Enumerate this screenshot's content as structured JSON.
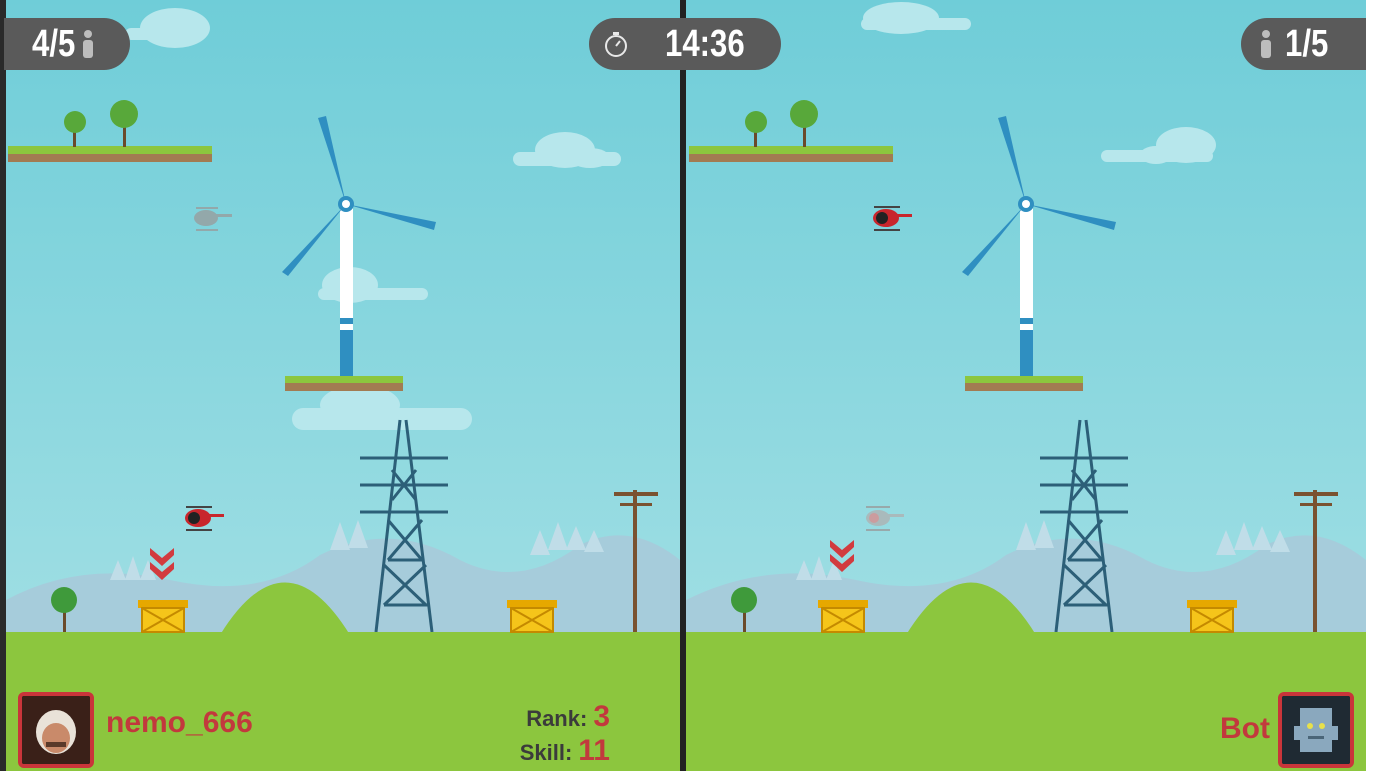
{
  "hud": {
    "lives_left": "4/5",
    "timer": "14:36",
    "lives_right": "1/5",
    "icons": {
      "person": "person-icon",
      "stopwatch": "stopwatch-icon"
    }
  },
  "player_left": {
    "name": "nemo_666",
    "rank_label": "Rank:",
    "rank": "3",
    "skill_label": "Skill:",
    "skill": "11"
  },
  "player_right": {
    "name": "Bot"
  },
  "colors": {
    "sky": "#7dd2dc",
    "grass": "#8cc63e",
    "accent_red": "#c2393d",
    "pill": "#5a5a5a",
    "turbine": "#2f8fc1"
  }
}
